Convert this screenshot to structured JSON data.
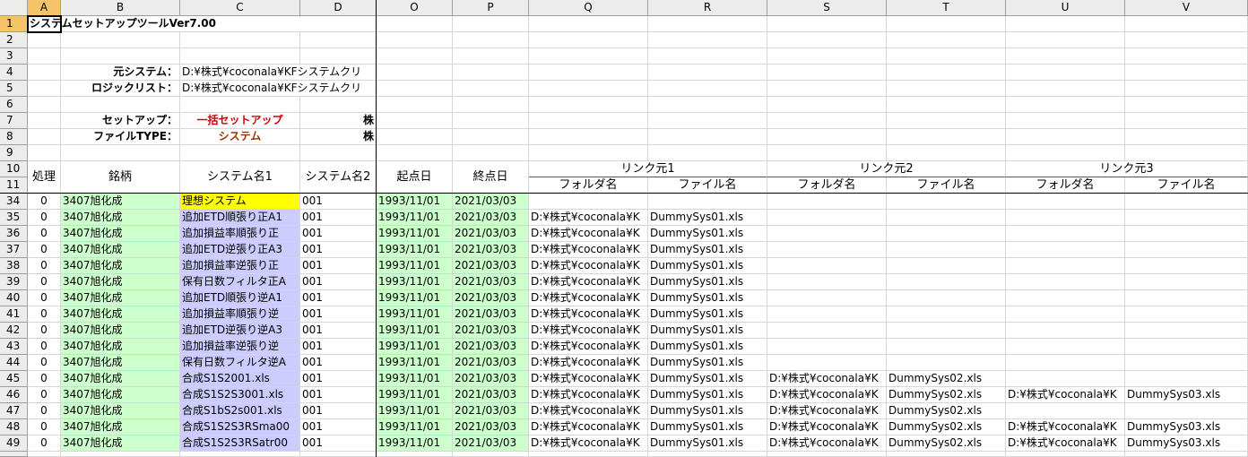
{
  "columns": [
    "A",
    "B",
    "C",
    "D",
    "O",
    "P",
    "Q",
    "R",
    "S",
    "T",
    "U",
    "V"
  ],
  "selected_column": "A",
  "selected_row": "1",
  "title": "システムセットアップツールVer7.00",
  "info": {
    "source_label": "元システム：",
    "source_value": "D:¥株式¥coconala¥KFシステムクリ",
    "logic_label": "ロジックリスト：",
    "logic_value": "D:¥株式¥coconala¥KFシステムクリ",
    "setup_label": "セットアップ：",
    "setup_value": "一括セットアップ",
    "filetype_label": "ファイルTYPE：",
    "filetype_value": "システム",
    "d7_text": "株",
    "d8_text": "株"
  },
  "table_headers": {
    "process": "処理",
    "ticker": "銘柄",
    "system1": "システム名1",
    "system2": "システム名2",
    "start": "起点日",
    "end": "終点日",
    "link1": "リンク元1",
    "link2": "リンク元2",
    "link3": "リンク元3",
    "folder": "フォルダ名",
    "file": "ファイル名"
  },
  "top_rows": [
    "1",
    "2",
    "3",
    "4",
    "5",
    "6",
    "7",
    "8",
    "9",
    "10",
    "11"
  ],
  "rows": [
    {
      "num": "34",
      "proc": "0",
      "ticker": "3407旭化成",
      "sys1": "理想システム",
      "sys2": "001",
      "start": "1993/11/01",
      "end": "2021/03/03",
      "f1": "",
      "n1": "",
      "f2": "",
      "n2": "",
      "f3": "",
      "n3": ""
    },
    {
      "num": "35",
      "proc": "0",
      "ticker": "3407旭化成",
      "sys1": "追加ETD順張り正A1",
      "sys2": "001",
      "start": "1993/11/01",
      "end": "2021/03/03",
      "f1": "D:¥株式¥coconala¥K",
      "n1": "DummySys01.xls",
      "f2": "",
      "n2": "",
      "f3": "",
      "n3": ""
    },
    {
      "num": "36",
      "proc": "0",
      "ticker": "3407旭化成",
      "sys1": "追加損益率順張り正",
      "sys2": "001",
      "start": "1993/11/01",
      "end": "2021/03/03",
      "f1": "D:¥株式¥coconala¥K",
      "n1": "DummySys01.xls",
      "f2": "",
      "n2": "",
      "f3": "",
      "n3": ""
    },
    {
      "num": "37",
      "proc": "0",
      "ticker": "3407旭化成",
      "sys1": "追加ETD逆張り正A3",
      "sys2": "001",
      "start": "1993/11/01",
      "end": "2021/03/03",
      "f1": "D:¥株式¥coconala¥K",
      "n1": "DummySys01.xls",
      "f2": "",
      "n2": "",
      "f3": "",
      "n3": ""
    },
    {
      "num": "38",
      "proc": "0",
      "ticker": "3407旭化成",
      "sys1": "追加損益率逆張り正",
      "sys2": "001",
      "start": "1993/11/01",
      "end": "2021/03/03",
      "f1": "D:¥株式¥coconala¥K",
      "n1": "DummySys01.xls",
      "f2": "",
      "n2": "",
      "f3": "",
      "n3": ""
    },
    {
      "num": "39",
      "proc": "0",
      "ticker": "3407旭化成",
      "sys1": "保有日数フィルタ正A",
      "sys2": "001",
      "start": "1993/11/01",
      "end": "2021/03/03",
      "f1": "D:¥株式¥coconala¥K",
      "n1": "DummySys01.xls",
      "f2": "",
      "n2": "",
      "f3": "",
      "n3": ""
    },
    {
      "num": "40",
      "proc": "0",
      "ticker": "3407旭化成",
      "sys1": "追加ETD順張り逆A1",
      "sys2": "001",
      "start": "1993/11/01",
      "end": "2021/03/03",
      "f1": "D:¥株式¥coconala¥K",
      "n1": "DummySys01.xls",
      "f2": "",
      "n2": "",
      "f3": "",
      "n3": ""
    },
    {
      "num": "41",
      "proc": "0",
      "ticker": "3407旭化成",
      "sys1": "追加損益率順張り逆",
      "sys2": "001",
      "start": "1993/11/01",
      "end": "2021/03/03",
      "f1": "D:¥株式¥coconala¥K",
      "n1": "DummySys01.xls",
      "f2": "",
      "n2": "",
      "f3": "",
      "n3": ""
    },
    {
      "num": "42",
      "proc": "0",
      "ticker": "3407旭化成",
      "sys1": "追加ETD逆張り逆A3",
      "sys2": "001",
      "start": "1993/11/01",
      "end": "2021/03/03",
      "f1": "D:¥株式¥coconala¥K",
      "n1": "DummySys01.xls",
      "f2": "",
      "n2": "",
      "f3": "",
      "n3": ""
    },
    {
      "num": "43",
      "proc": "0",
      "ticker": "3407旭化成",
      "sys1": "追加損益率逆張り逆",
      "sys2": "001",
      "start": "1993/11/01",
      "end": "2021/03/03",
      "f1": "D:¥株式¥coconala¥K",
      "n1": "DummySys01.xls",
      "f2": "",
      "n2": "",
      "f3": "",
      "n3": ""
    },
    {
      "num": "44",
      "proc": "0",
      "ticker": "3407旭化成",
      "sys1": "保有日数フィルタ逆A",
      "sys2": "001",
      "start": "1993/11/01",
      "end": "2021/03/03",
      "f1": "D:¥株式¥coconala¥K",
      "n1": "DummySys01.xls",
      "f2": "",
      "n2": "",
      "f3": "",
      "n3": ""
    },
    {
      "num": "45",
      "proc": "0",
      "ticker": "3407旭化成",
      "sys1": "合成S1S2001.xls",
      "sys2": "001",
      "start": "1993/11/01",
      "end": "2021/03/03",
      "f1": "D:¥株式¥coconala¥K",
      "n1": "DummySys01.xls",
      "f2": "D:¥株式¥coconala¥K",
      "n2": "DummySys02.xls",
      "f3": "",
      "n3": ""
    },
    {
      "num": "46",
      "proc": "0",
      "ticker": "3407旭化成",
      "sys1": "合成S1S2S3001.xls",
      "sys2": "001",
      "start": "1993/11/01",
      "end": "2021/03/03",
      "f1": "D:¥株式¥coconala¥K",
      "n1": "DummySys01.xls",
      "f2": "D:¥株式¥coconala¥K",
      "n2": "DummySys02.xls",
      "f3": "D:¥株式¥coconala¥K",
      "n3": "DummySys03.xls"
    },
    {
      "num": "47",
      "proc": "0",
      "ticker": "3407旭化成",
      "sys1": "合成S1bS2s001.xls",
      "sys2": "001",
      "start": "1993/11/01",
      "end": "2021/03/03",
      "f1": "D:¥株式¥coconala¥K",
      "n1": "DummySys01.xls",
      "f2": "D:¥株式¥coconala¥K",
      "n2": "DummySys02.xls",
      "f3": "",
      "n3": ""
    },
    {
      "num": "48",
      "proc": "0",
      "ticker": "3407旭化成",
      "sys1": "合成S1S2S3RSma00",
      "sys2": "001",
      "start": "1993/11/01",
      "end": "2021/03/03",
      "f1": "D:¥株式¥coconala¥K",
      "n1": "DummySys01.xls",
      "f2": "D:¥株式¥coconala¥K",
      "n2": "DummySys02.xls",
      "f3": "D:¥株式¥coconala¥K",
      "n3": "DummySys03.xls"
    },
    {
      "num": "49",
      "proc": "0",
      "ticker": "3407旭化成",
      "sys1": "合成S1S2S3RSatr00",
      "sys2": "001",
      "start": "1993/11/01",
      "end": "2021/03/03",
      "f1": "D:¥株式¥coconala¥K",
      "n1": "DummySys01.xls",
      "f2": "D:¥株式¥coconala¥K",
      "n2": "DummySys02.xls",
      "f3": "D:¥株式¥coconala¥K",
      "n3": "DummySys03.xls"
    }
  ]
}
